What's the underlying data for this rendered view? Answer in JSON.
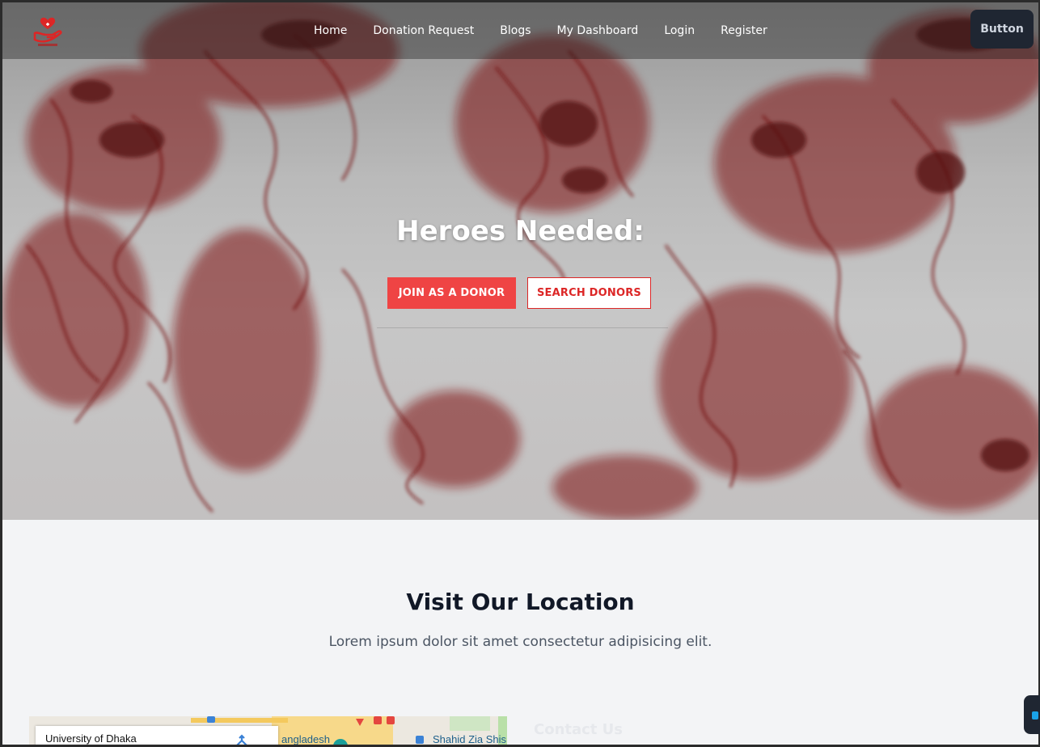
{
  "nav": {
    "logo_icon": "blood-donation-hand-heart-icon",
    "links": [
      "Home",
      "Donation Request",
      "Blogs",
      "My Dashboard",
      "Login",
      "Register"
    ],
    "button_label": "Button"
  },
  "hero": {
    "title": "Heroes Needed:",
    "primary_button": "JOIN AS A DONOR",
    "secondary_button": "SEARCH DONORS"
  },
  "location": {
    "title": "Visit Our Location",
    "subtitle": "Lorem ipsum dolor sit amet consectetur adipisicing elit.",
    "map": {
      "card_title": "University of Dhaka",
      "labels": [
        "angladesh",
        "Shahid Zia Shis"
      ]
    },
    "contact_title": "Contact Us"
  },
  "colors": {
    "accent": "#ef4444",
    "accent_dark": "#dc2626",
    "nav_button": "#1f2632",
    "heading": "#111827"
  }
}
